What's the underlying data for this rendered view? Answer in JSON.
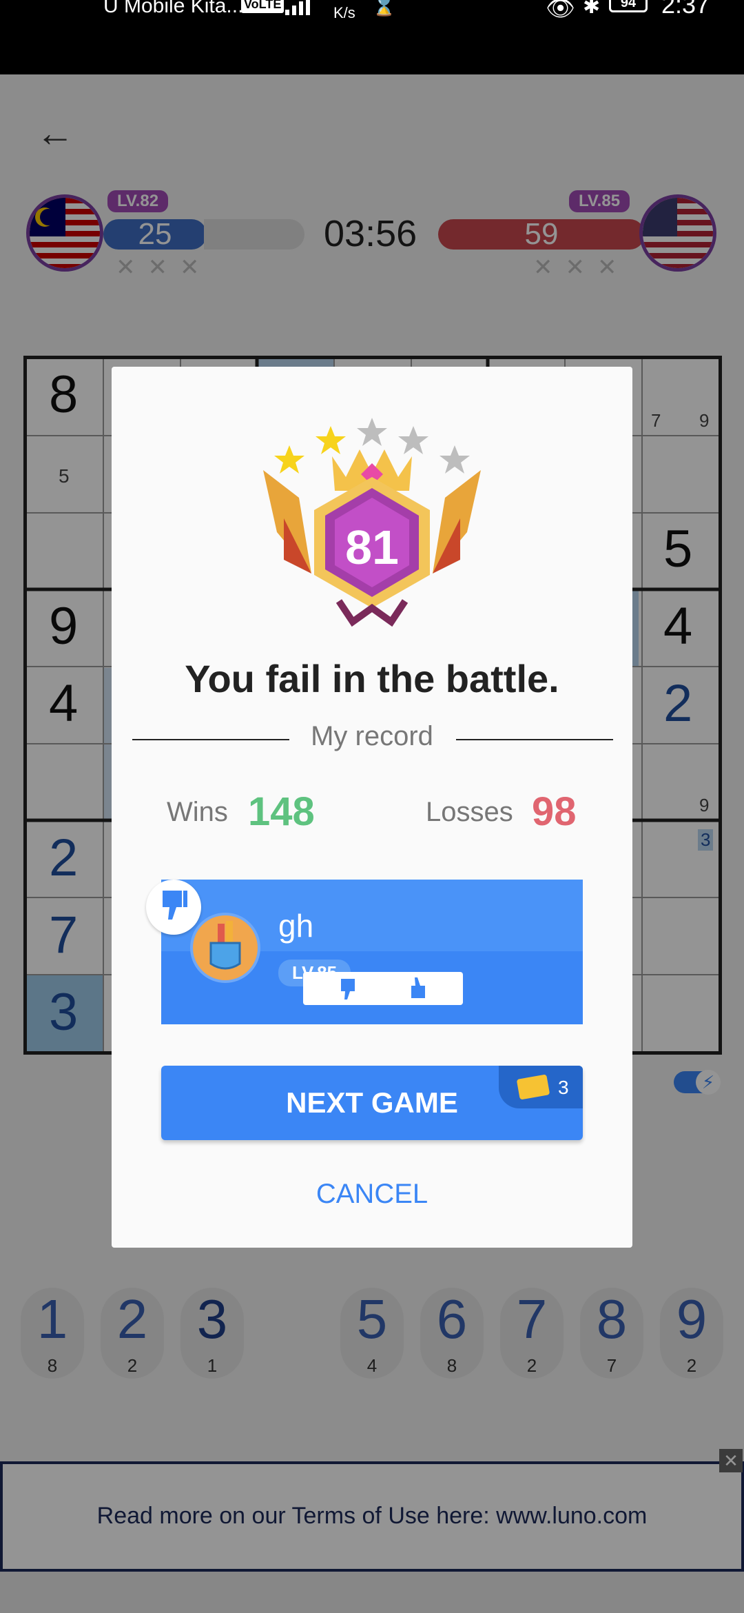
{
  "status_bar": {
    "carrier": "U Mobile Kita...",
    "volte": "VoLTE",
    "speed_unit": "K/s",
    "battery": "94",
    "time": "2:37"
  },
  "game": {
    "left_player": {
      "level": "LV.82",
      "score": "25",
      "flag_icon": "malaysia-flag-icon"
    },
    "right_player": {
      "level": "LV.85",
      "score": "59",
      "flag_icon": "usa-flag-icon"
    },
    "timer": "03:56",
    "mistake_marks": "✕✕✕",
    "grid_visible_values": [
      "8",
      "5",
      "9",
      "4",
      "2",
      "7",
      "3",
      "5",
      "4",
      "2",
      "7",
      "9",
      "9",
      "3"
    ],
    "number_pad": [
      {
        "digit": "1",
        "remaining": "8"
      },
      {
        "digit": "2",
        "remaining": "2"
      },
      {
        "digit": "3",
        "remaining": "1"
      },
      {
        "digit": "5",
        "remaining": "4"
      },
      {
        "digit": "6",
        "remaining": "8"
      },
      {
        "digit": "7",
        "remaining": "2"
      },
      {
        "digit": "8",
        "remaining": "7"
      },
      {
        "digit": "9",
        "remaining": "2"
      }
    ]
  },
  "dialog": {
    "badge_level": "81",
    "stars_filled": 2,
    "stars_total": 5,
    "result_text": "You fail in the battle.",
    "record_title": "My record",
    "wins_label": "Wins",
    "wins_value": "148",
    "losses_label": "Losses",
    "losses_value": "98",
    "opponent": {
      "name": "gh",
      "level": "LV.85"
    },
    "next_game_label": "NEXT GAME",
    "ticket_count": "3",
    "cancel_label": "CANCEL"
  },
  "ad": {
    "text": "Read more on our Terms of Use here: www.luno.com"
  },
  "colors": {
    "accent": "#3b86f5",
    "wins": "#5ec27f",
    "losses": "#e06570",
    "purple": "#a04ab6"
  }
}
